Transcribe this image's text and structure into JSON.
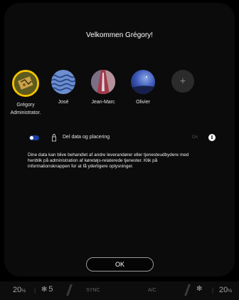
{
  "screen": {
    "welcome": "Velkommen Grégory!"
  },
  "profiles": [
    {
      "name": "Grégory",
      "role": "Administrator.",
      "icon": "map-avatar-icon",
      "selected": true
    },
    {
      "name": "José",
      "role": "",
      "icon": "wave-avatar-icon",
      "selected": false
    },
    {
      "name": "Jean-Marc",
      "role": "",
      "icon": "road-avatar-icon",
      "selected": false
    },
    {
      "name": "Olivier",
      "role": "",
      "icon": "night-sky-avatar-icon",
      "selected": false
    }
  ],
  "add_profile": {
    "symbol": "+"
  },
  "data_sharing": {
    "label": "Del data og placering",
    "state_label": "On",
    "enabled": true,
    "info_symbol": "i",
    "description": "Dine data kan blive behandlet af andre leverandører eller tjenesteudbydere med henblik på administration af køretøjs-relaterede tjenester. Klik på informationsknappen for at få yderligere oplysninger."
  },
  "ok_button": {
    "label": "OK"
  },
  "climate_bar": {
    "left_temp": "20",
    "left_temp_unit": "½",
    "fan_speed": "5",
    "sync_label": "SYNC",
    "ac_label": "A/C",
    "right_temp": "20",
    "right_temp_unit": "½"
  },
  "colors": {
    "selected_ring": "#f2c200",
    "toggle_on": "#1a3ea0"
  }
}
